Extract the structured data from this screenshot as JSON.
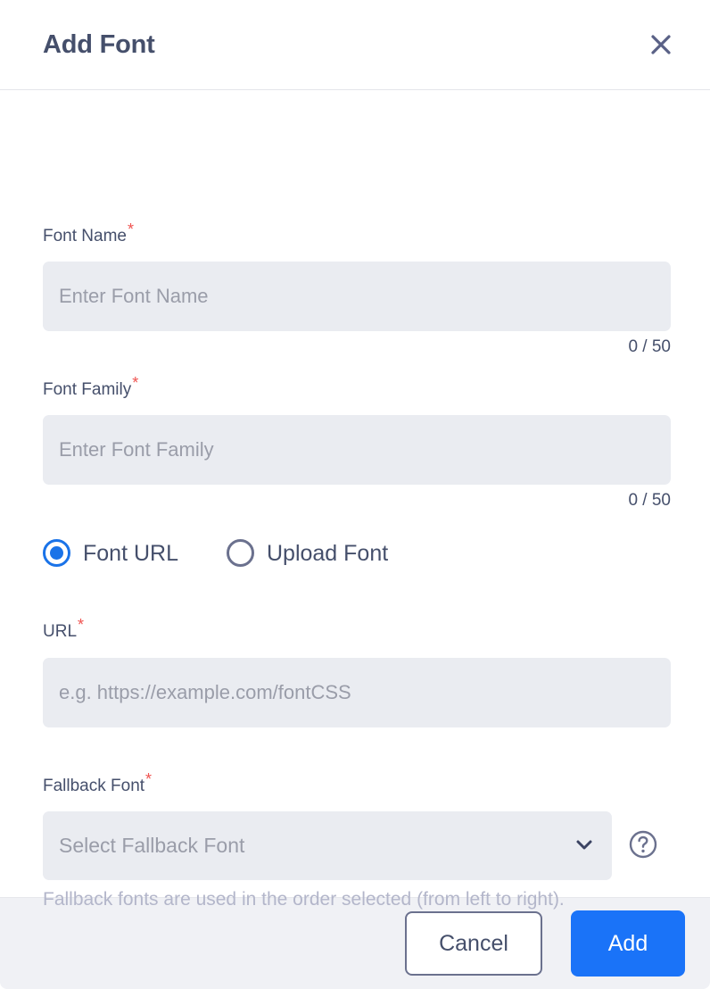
{
  "dialog": {
    "title": "Add Font",
    "close_icon": "close-icon"
  },
  "form": {
    "font_name": {
      "label": "Font Name",
      "required_marker": "*",
      "placeholder": "Enter Font Name",
      "value": "",
      "counter": "0 / 50"
    },
    "font_family": {
      "label": "Font Family",
      "required_marker": "*",
      "placeholder": "Enter Font Family",
      "value": "",
      "counter": "0 / 50"
    },
    "source_type": {
      "selected": "Font URL",
      "options": [
        {
          "label": "Font URL",
          "selected": true
        },
        {
          "label": "Upload Font",
          "selected": false
        }
      ]
    },
    "url": {
      "label": "URL",
      "required_marker": "*",
      "placeholder": "e.g. https://example.com/fontCSS",
      "value": ""
    },
    "fallback_font": {
      "label": "Fallback Font",
      "required_marker": "*",
      "placeholder": "Select Fallback Font",
      "value": "",
      "chevron_icon": "chevron-down-icon",
      "help_icon": "help-circle-icon",
      "hint": "Fallback fonts are used in the order selected (from left to right)."
    }
  },
  "footer": {
    "cancel_label": "Cancel",
    "add_label": "Add"
  },
  "colors": {
    "accent_blue": "#1a73f8",
    "radio_blue": "#1a73e8",
    "text_slate": "#454f6b",
    "placeholder_gray": "#9a9da9",
    "input_bg": "#eaecf1",
    "footer_bg": "#f0f1f5",
    "required_red": "#ef5350",
    "hint_gray": "#b3b6ca"
  }
}
